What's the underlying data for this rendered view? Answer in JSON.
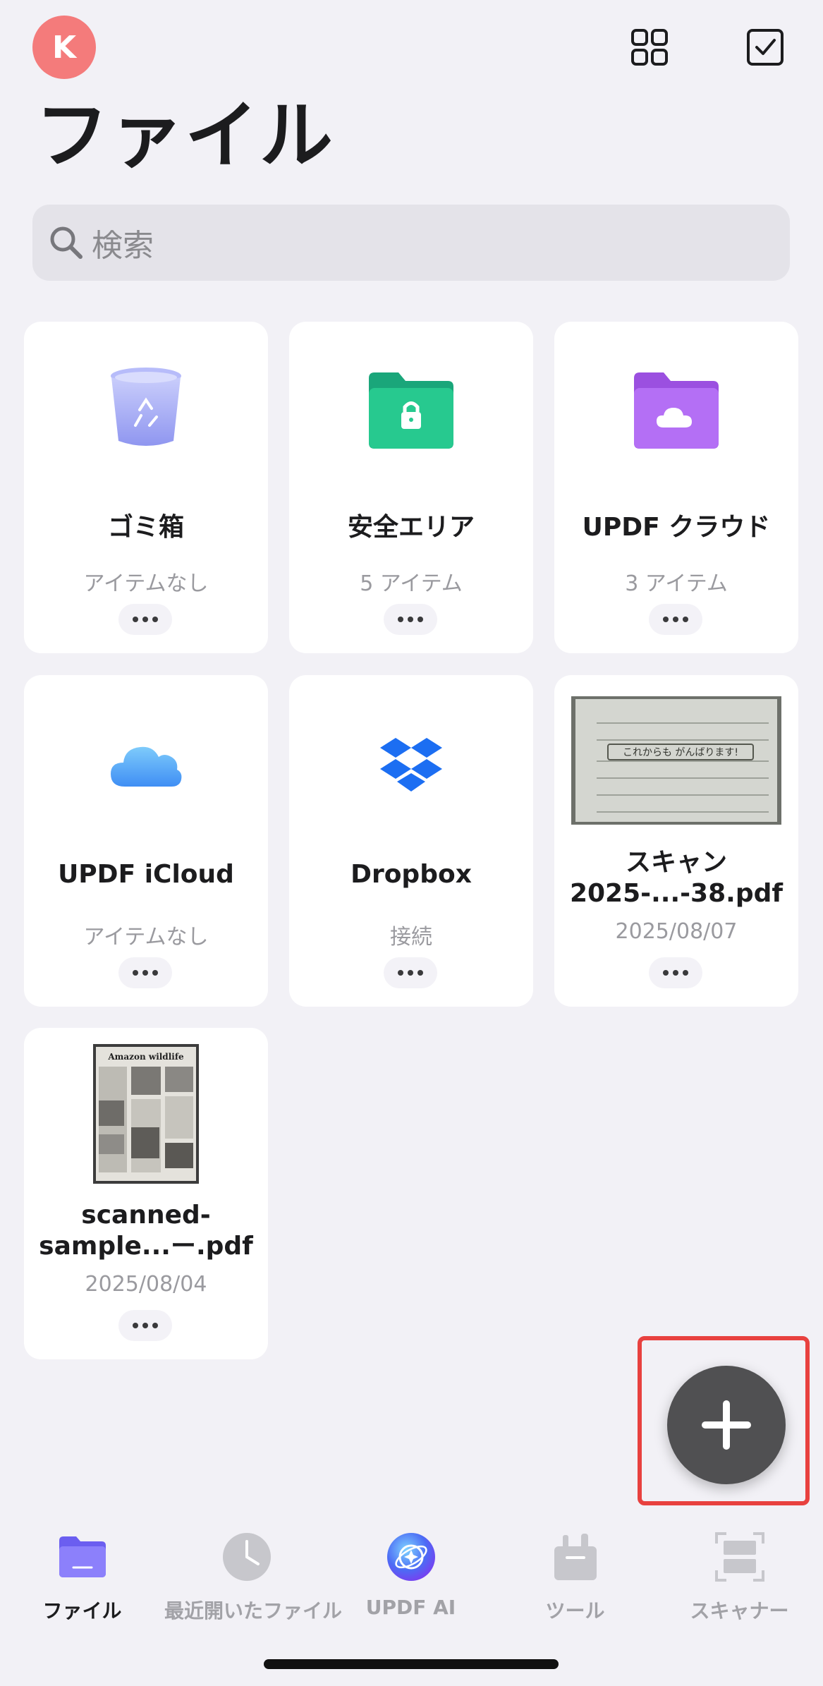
{
  "header": {
    "avatar_letter": "K",
    "title": "ファイル"
  },
  "search": {
    "placeholder": "検索"
  },
  "items": [
    {
      "name": "ゴミ箱",
      "sub": "アイテムなし",
      "icon": "trash-icon"
    },
    {
      "name": "安全エリア",
      "sub": "5 アイテム",
      "icon": "secure-folder-icon"
    },
    {
      "name": "UPDF クラウド",
      "sub": "3 アイテム",
      "icon": "cloud-folder-icon"
    },
    {
      "name": "UPDF iCloud",
      "sub": "アイテムなし",
      "icon": "icloud-icon"
    },
    {
      "name": "Dropbox",
      "sub": "接続",
      "icon": "dropbox-icon"
    },
    {
      "name": "スキャン 2025-...-38.pdf",
      "sub": "2025/08/07",
      "icon": "scan-thumbnail"
    },
    {
      "name": "scanned-sample...ー.pdf",
      "sub": "2025/08/04",
      "icon": "pdf-thumbnail"
    }
  ],
  "thumbnails": {
    "handwriting_text": "これからも がんばります!",
    "magazine_title": "Amazon wildlife"
  },
  "tabs": [
    {
      "label": "ファイル",
      "icon": "folder-icon",
      "active": true
    },
    {
      "label": "最近開いたファイル",
      "icon": "clock-icon",
      "active": false
    },
    {
      "label": "UPDF AI",
      "icon": "ai-icon",
      "active": false
    },
    {
      "label": "ツール",
      "icon": "toolbox-icon",
      "active": false
    },
    {
      "label": "スキャナー",
      "icon": "scanner-icon",
      "active": false
    }
  ],
  "colors": {
    "background": "#f2f1f6",
    "avatar": "#f47b7b",
    "fab": "#505052",
    "highlight": "#e8413f",
    "active_tab": "#1c1c1e",
    "inactive_tab": "#a2a2a7"
  }
}
